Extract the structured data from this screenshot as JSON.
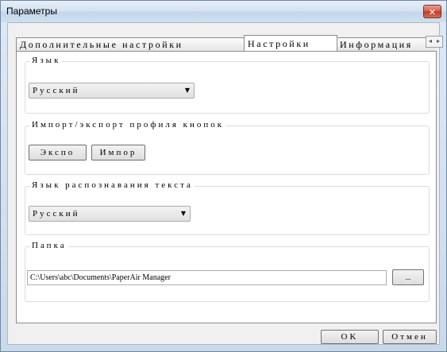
{
  "window": {
    "title": "Параметры",
    "close_glyph": "✕"
  },
  "tabs": [
    {
      "label": "Дополнительные настройки"
    },
    {
      "label": "Настройки"
    },
    {
      "label": "Информация"
    }
  ],
  "scroll": {
    "left": "◂",
    "right": "▸"
  },
  "groups": {
    "language": {
      "legend": "Язык",
      "selected": "Русский"
    },
    "profile": {
      "legend": "Импорт/экспорт профиля кнопок",
      "export_label": "Экспо",
      "import_label": "Импор"
    },
    "ocr": {
      "legend": "Язык распознавания текста",
      "selected": "Русский"
    },
    "folder": {
      "legend": "Папка",
      "path": "C:\\Users\\abc\\Documents\\PaperAir Manager",
      "browse_label": "..."
    }
  },
  "footer": {
    "ok_label": "OK",
    "cancel_label": "Отмен"
  },
  "icons": {
    "close": "close-icon",
    "combo_arrow": "chevron-down-icon"
  },
  "colors": {
    "titlebar": "#cfdff0",
    "close": "#c0392b",
    "client": "#f0f0f0"
  }
}
